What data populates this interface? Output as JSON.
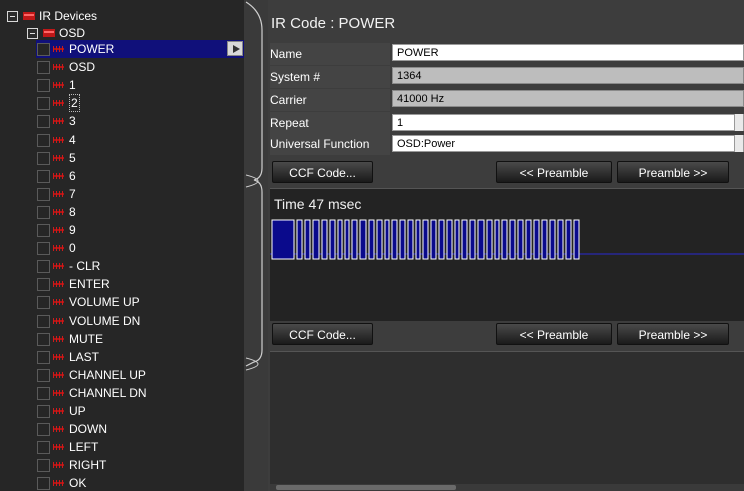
{
  "tree": {
    "root_label": "IR Devices",
    "device_label": "OSD",
    "items": [
      "POWER",
      "OSD",
      "1",
      "2",
      "3",
      "4",
      "5",
      "6",
      "7",
      "8",
      "9",
      "0",
      "- CLR",
      "ENTER",
      "VOLUME UP",
      "VOLUME DN",
      "MUTE",
      "LAST",
      "CHANNEL UP",
      "CHANNEL DN",
      "UP",
      "DOWN",
      "LEFT",
      "RIGHT",
      "OK"
    ],
    "selected_item": "POWER",
    "focused_item": "2"
  },
  "detail": {
    "title": "IR Code : POWER",
    "fields": {
      "name": {
        "label": "Name",
        "value": "POWER"
      },
      "system": {
        "label": "System #",
        "value": "1364"
      },
      "carrier": {
        "label": "Carrier",
        "value": "41000 Hz"
      },
      "repeat": {
        "label": "Repeat",
        "value": "1"
      },
      "universal_function": {
        "label": "Universal Function",
        "value": "OSD:Power"
      }
    },
    "ccf_button": "CCF Code...",
    "prev_preamble_button": "<< Preamble",
    "next_preamble_button": "Preamble >>",
    "time_label": "Time 47 msec"
  },
  "colors": {
    "pulse_fill": "#0a0a8c",
    "pulse_border": "#ffffff",
    "selection": "#10107a",
    "device_icon": "#c01818"
  }
}
